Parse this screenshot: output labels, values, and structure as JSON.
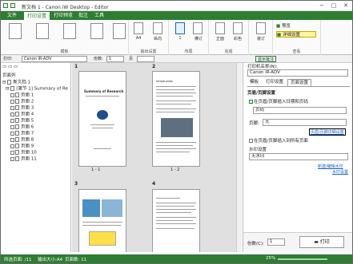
{
  "window": {
    "title": "新文档 1 - Canon iW Desktop - Editor"
  },
  "menu": {
    "tabs": [
      "文件",
      "打印设置",
      "打印预览",
      "批注",
      "工具"
    ]
  },
  "ribbon": {
    "groups": [
      "模板",
      "输出设置",
      "布局",
      "完成",
      "",
      "查看"
    ],
    "items": [
      "A4",
      "纵向",
      "1",
      "横订",
      "正面",
      "彩色",
      "装订"
    ],
    "view": {
      "preview_label": "预览",
      "detail_label": "详细设置"
    }
  },
  "toolbar": {
    "printer_label": "打印:",
    "printer_value": "Canon iR-ADV",
    "copies_label": "份数:",
    "copies_value": "1",
    "pages_label": "页",
    "show_comment": "显示批注"
  },
  "left": {
    "title": "页面列",
    "tree": [
      {
        "label": "新文档 1",
        "icon": "doc-icon"
      },
      {
        "label": "[第节 1] Summary of Re",
        "icon": "doc-icon"
      },
      {
        "label": "页面 1"
      },
      {
        "label": "页面 2"
      },
      {
        "label": "页面 3"
      },
      {
        "label": "页面 4"
      },
      {
        "label": "页面 5"
      },
      {
        "label": "页面 6"
      },
      {
        "label": "页面 7"
      },
      {
        "label": "页面 8"
      },
      {
        "label": "页面 9"
      },
      {
        "label": "页面 10"
      },
      {
        "label": "页面 11"
      }
    ]
  },
  "center": {
    "pages": [
      {
        "num": "1",
        "caption": "1 - 1",
        "title": "Summary of Research"
      },
      {
        "num": "2",
        "caption": "1 - 2",
        "title": "Introduction"
      },
      {
        "num": "3",
        "caption": "",
        "title": ""
      },
      {
        "num": "4",
        "caption": "",
        "title": ""
      }
    ]
  },
  "right": {
    "printer_label": "打印机名称(N):",
    "printer_value": "Canon iR-ADV",
    "tabs": [
      "模板",
      "打印设置",
      "页面设置"
    ],
    "section_title": "页眉/页脚设置",
    "checkbox1": "在页眉/页脚插入日期和页码",
    "header_label": "页眉:",
    "header_value": "页码",
    "footer_label": "页脚:",
    "footer_value": "无",
    "link": "页眉/页脚详细设置",
    "checkbox2": "在页眉/页脚插入到所有页面",
    "watermark_title": "水印设置",
    "watermark_value": "无水印",
    "link2": "新建/编辑水印",
    "link3": "水印设置",
    "copies_label": "份数(C):",
    "copies_value": "1",
    "print_label": "打印"
  },
  "status": {
    "total": "所选页面: /11",
    "size": "输出大小:A4",
    "pages": "页面数: 11",
    "zoom": "25%"
  },
  "colors": {
    "accent": "#2e7d32",
    "link": "#1565c0"
  }
}
